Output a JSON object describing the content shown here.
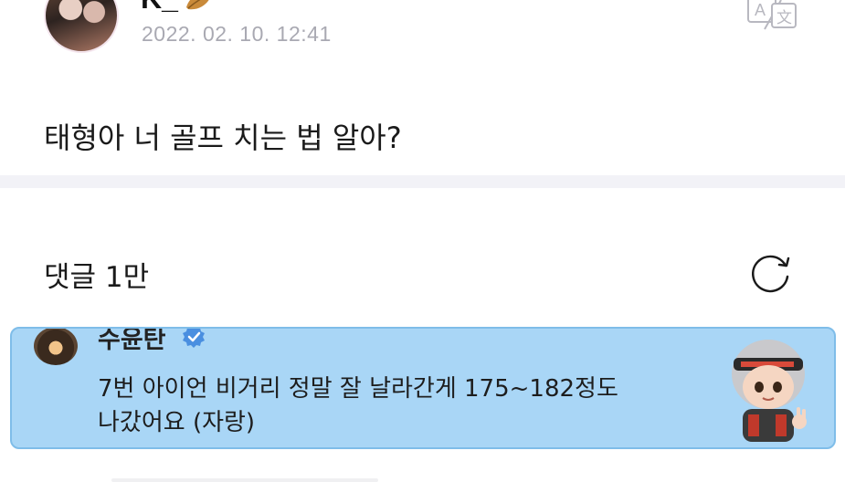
{
  "post": {
    "author": "K_",
    "timestamp": "2022. 02. 10. 12:41",
    "body": "태형아 너 골프 치는 법 알아?"
  },
  "comments": {
    "header": "댓글 1만",
    "items": [
      {
        "name": "수윤탄",
        "text_line1": "7번 아이언 비거리 정말 잘 날라간게 175~182정도",
        "text_line2": "나갔어요 (자랑)"
      }
    ]
  },
  "icons": {
    "translate": "translate-icon",
    "refresh": "refresh-icon",
    "verified": "verified-icon"
  },
  "colors": {
    "highlight_card": "#a9d6f6",
    "verified": "#4a8fe0",
    "timestamp": "#a9a9b2"
  }
}
